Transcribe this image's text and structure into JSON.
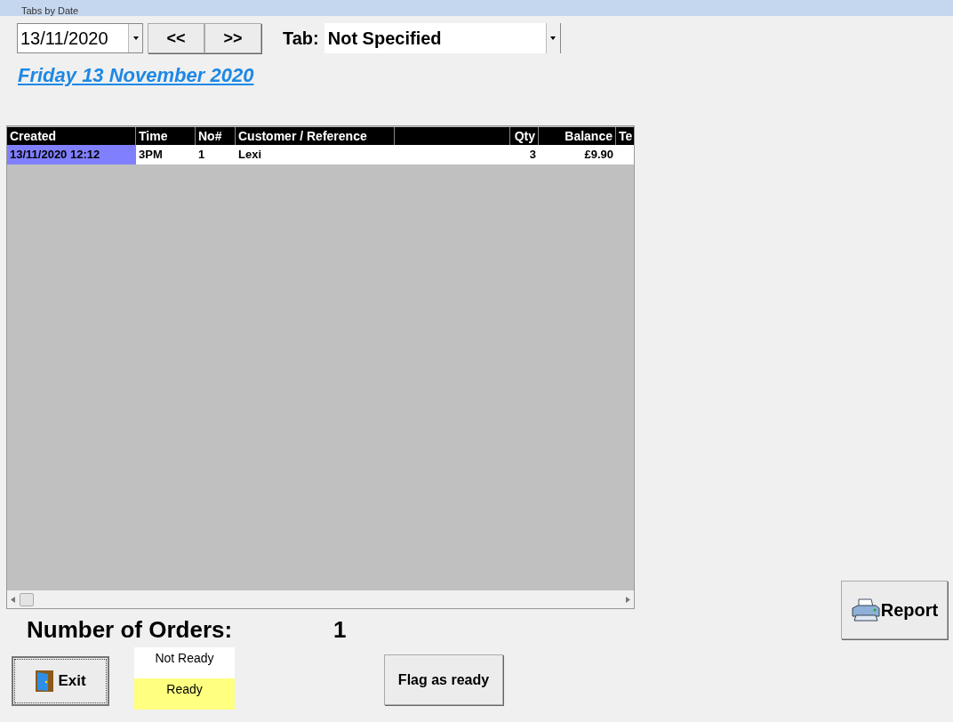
{
  "window": {
    "title": "Tabs by Date"
  },
  "date_picker": {
    "value": "13/11/2020"
  },
  "nav_buttons": [
    "<<",
    ">>"
  ],
  "tab_filter": {
    "label": "Tab:",
    "value": "Not Specified"
  },
  "date_heading": "Friday 13 November 2020",
  "table": {
    "columns": [
      "Created",
      "Time",
      "No#",
      "Customer / Reference",
      "Qty",
      "Balance",
      "Te"
    ],
    "rows": [
      {
        "cells": [
          "13/11/2020 12:12",
          "3PM",
          "1",
          "Lexi",
          "3",
          "£9.90"
        ],
        "selected": true
      }
    ]
  },
  "order_count": {
    "label": "Number of Orders:",
    "value": "1"
  },
  "legend": [
    {
      "label": "Not Ready",
      "color": "#ffffff"
    },
    {
      "label": "Ready",
      "color": "#ffff80"
    }
  ],
  "buttons": {
    "exit": "Exit",
    "flag": "Flag as ready",
    "report": "Report"
  }
}
